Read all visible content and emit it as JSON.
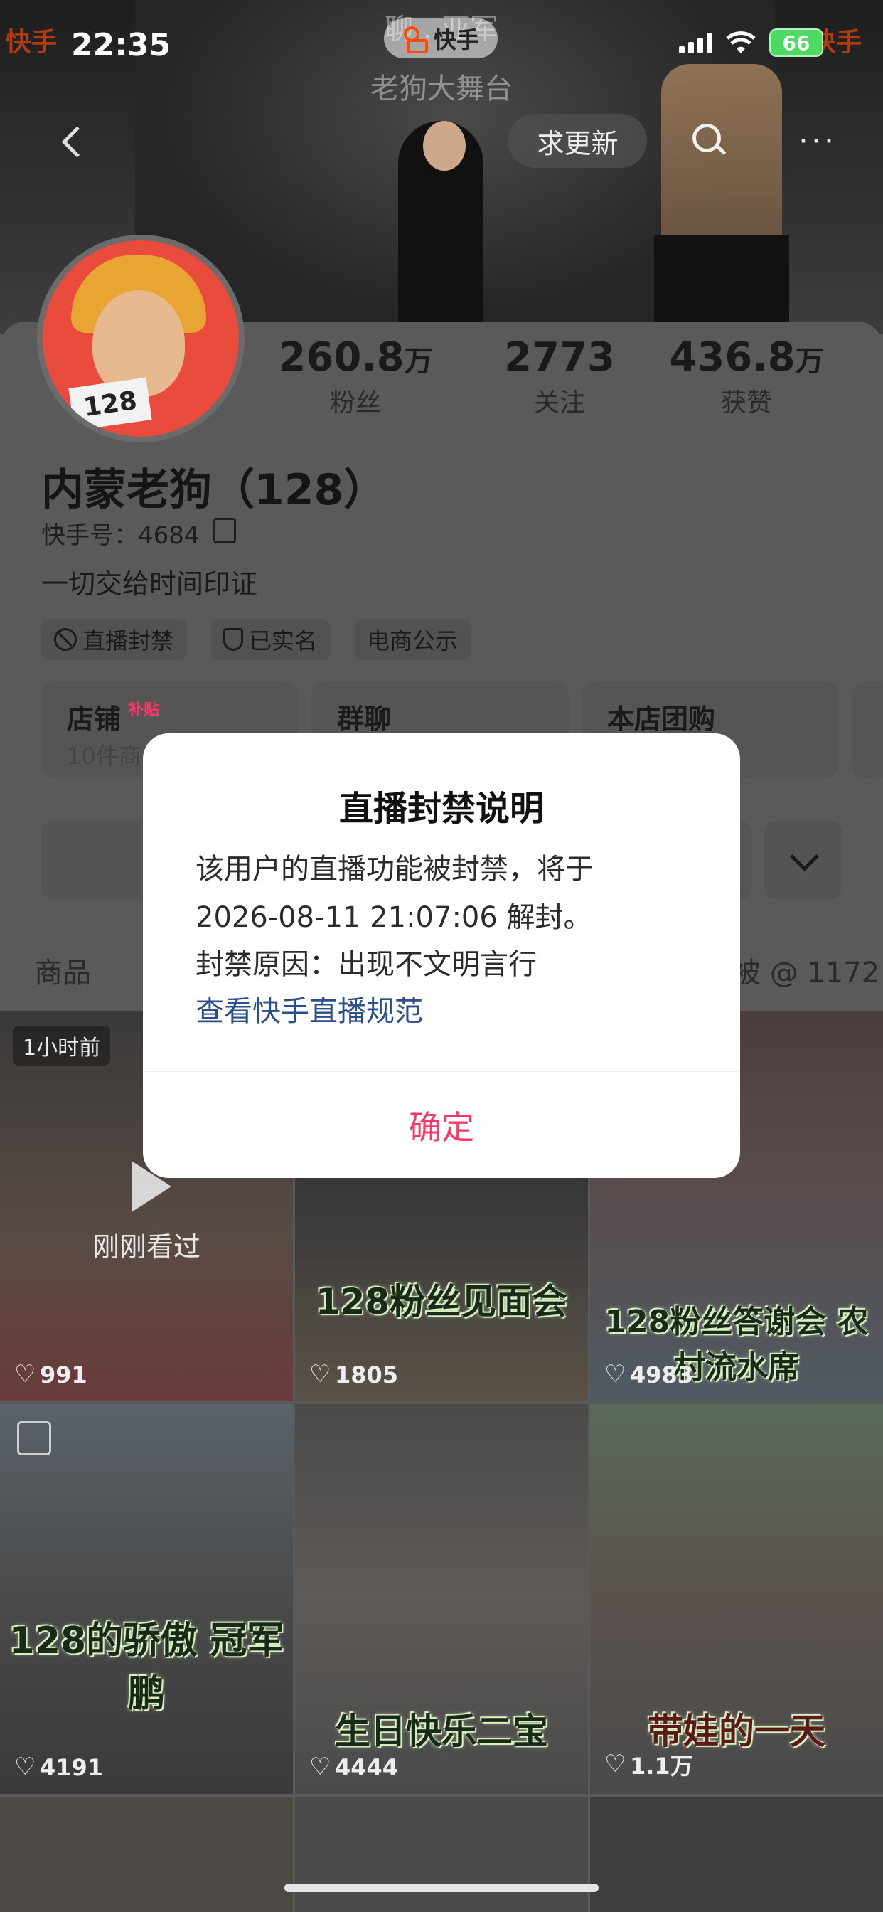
{
  "status_bar": {
    "time": "22:35",
    "battery": "66"
  },
  "banner": {
    "line1": "聊…亚军",
    "line2": "老狗大舞台",
    "app_pill": "快手",
    "corner_logo": "快手"
  },
  "header": {
    "update_button": "求更新",
    "more": "···"
  },
  "profile": {
    "name": "内蒙老狗（128）",
    "kuaishou_id": "快手号：4684",
    "bio": "一切交给时间印证",
    "avatar_sign": "128",
    "stats": [
      {
        "value": "260.8",
        "unit": "万",
        "label": "粉丝"
      },
      {
        "value": "2773",
        "unit": "",
        "label": "关注"
      },
      {
        "value": "436.8",
        "unit": "万",
        "label": "获赞"
      }
    ],
    "tags": [
      "直播封禁",
      "已实名",
      "电商公示"
    ]
  },
  "shortcuts": [
    {
      "title": "店铺",
      "badge": "补贴",
      "subtitle": "10件商"
    },
    {
      "title": "群聊",
      "badge": "",
      "subtitle": ""
    },
    {
      "title": "本店团购",
      "badge": "",
      "subtitle": ""
    }
  ],
  "tabs": {
    "goods": "商品",
    "mentioned": "被 @ 1172"
  },
  "grid": [
    {
      "caption": "",
      "likes": "991",
      "time_badge": "1小时前",
      "watched": "刚刚看过"
    },
    {
      "caption": "128粉丝见面会",
      "likes": "1805"
    },
    {
      "caption": "128粉丝答谢会 农村流水席",
      "likes": "4983"
    },
    {
      "caption": "128的骄傲 冠军鹏",
      "likes": "4191"
    },
    {
      "caption": "生日快乐二宝",
      "likes": "4444"
    },
    {
      "caption": "带娃的一天",
      "likes": "1.1万"
    }
  ],
  "dialog": {
    "title": "直播封禁说明",
    "line1": "该用户的直播功能被封禁，将于",
    "line2": "2026-08-11 21:07:06 解封。",
    "line3": "封禁原因：出现不文明言行",
    "link": "查看快手直播规范",
    "confirm": "确定"
  },
  "colors": {
    "accent": "#fe3666",
    "link": "#2a4f8a",
    "brand": "#ff4906"
  }
}
